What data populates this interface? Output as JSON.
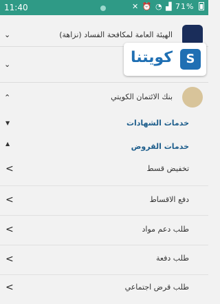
{
  "status_bar": {
    "time": "11:40",
    "battery": "71%"
  },
  "accordion": [
    {
      "label": "الهيئة العامة لمكافحة الفساد (نزاهة)",
      "state": "collapsed",
      "chevron": "⌄"
    },
    {
      "label": "",
      "state": "collapsed",
      "chevron": "⌄"
    },
    {
      "label": "بنك الائتمان الكويتي",
      "state": "expanded",
      "chevron": "⌃"
    }
  ],
  "sections": {
    "certificates": {
      "title": "خدمات الشهادات",
      "state": "collapsed"
    },
    "loans": {
      "title": "خدمات القروض",
      "state": "expanded"
    }
  },
  "loan_services": [
    {
      "label": "تخفيض قسط"
    },
    {
      "label": "دفع الاقساط"
    },
    {
      "label": "طلب دعم مواد"
    },
    {
      "label": "طلب دفعة"
    },
    {
      "label": "طلب قرض اجتماعي"
    }
  ],
  "overlay_badge": {
    "text": "كويتنا",
    "icon_letter": "S"
  },
  "colors": {
    "status_bar": "#2f9a86",
    "section_title": "#1e5e8c",
    "badge_blue": "#1f6fb3"
  }
}
